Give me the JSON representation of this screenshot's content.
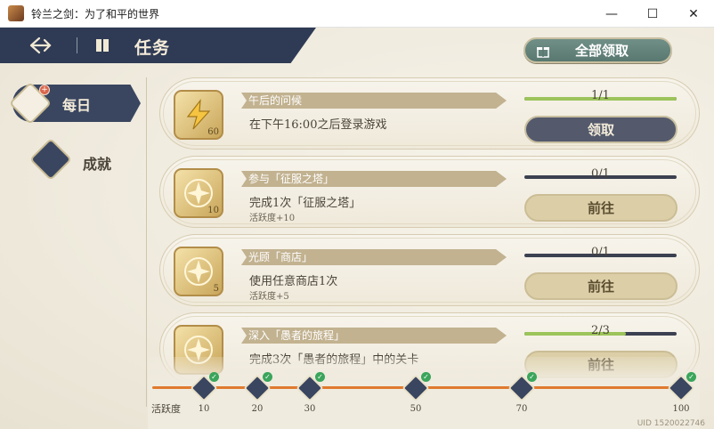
{
  "window": {
    "title": "铃兰之剑：为了和平的世界",
    "minimize": "—",
    "maximize": "☐",
    "close": "✕"
  },
  "header": {
    "title": "任务",
    "claim_all": "全部领取"
  },
  "nav": {
    "daily": "每日",
    "daily_badge": "+",
    "achievements": "成就"
  },
  "tasks": [
    {
      "name": "午后的问候",
      "desc": "在下午16:00之后登录游戏",
      "activity": "",
      "progress_text": "1/1",
      "progress": 1.0,
      "button": "领取",
      "button_style": "claim",
      "reward": "60"
    },
    {
      "name": "参与「征服之塔」",
      "desc": "完成1次「征服之塔」",
      "activity": "活跃度+10",
      "progress_text": "0/1",
      "progress": 0.0,
      "button": "前往",
      "button_style": "go",
      "reward": "10"
    },
    {
      "name": "光顾「商店」",
      "desc": "使用任意商店1次",
      "activity": "活跃度+5",
      "progress_text": "0/1",
      "progress": 0.0,
      "button": "前往",
      "button_style": "go",
      "reward": "5"
    },
    {
      "name": "深入「愚者的旅程」",
      "desc": "完成3次「愚者的旅程」中的关卡",
      "activity": "",
      "progress_text": "2/3",
      "progress": 0.667,
      "button": "前往",
      "button_style": "go",
      "reward": ""
    }
  ],
  "activity_track": {
    "label": "活跃度",
    "milestones": [
      "10",
      "20",
      "30",
      "50",
      "70",
      "100"
    ],
    "check": "✓"
  },
  "uid": "UID 1520022746",
  "colors": {
    "navy": "#2f3b55",
    "gold": "#c9a65a",
    "green_progress": "#9cc45a",
    "orange_track": "#e07a2e"
  }
}
